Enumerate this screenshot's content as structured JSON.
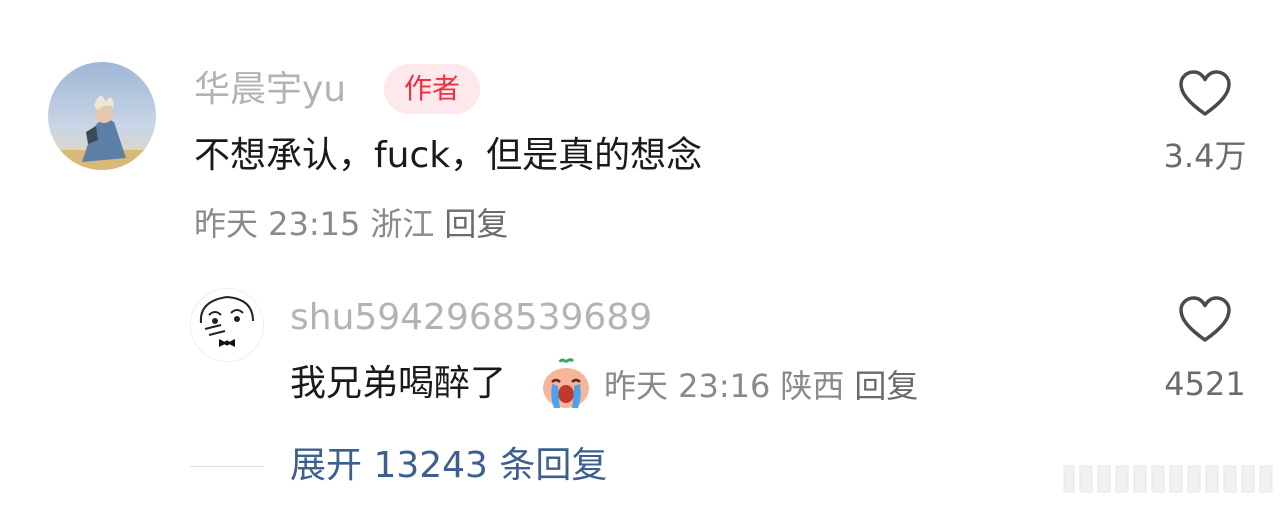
{
  "comment": {
    "username": "华晨宇yu",
    "author_badge": "作者",
    "text": "不想承认，fuck，但是真的想念",
    "time": "昨天 23:15",
    "location": "浙江",
    "reply_label": "回复",
    "like_count": "3.4万"
  },
  "reply": {
    "username": "shu5942968539689",
    "text": "我兄弟喝醉了",
    "time": "昨天 23:16",
    "location": "陕西",
    "reply_label": "回复",
    "like_count": "4521"
  },
  "expand": {
    "label": "展开 13243 条回复"
  },
  "icons": {
    "like": "heart-outline-icon",
    "sticker": "crying-emoji-sticker"
  },
  "colors": {
    "badge_text": "#f0303f",
    "badge_bg": "#fde8eb",
    "expand_link": "#3d5f8f",
    "muted_text": "#b3b3b3"
  }
}
